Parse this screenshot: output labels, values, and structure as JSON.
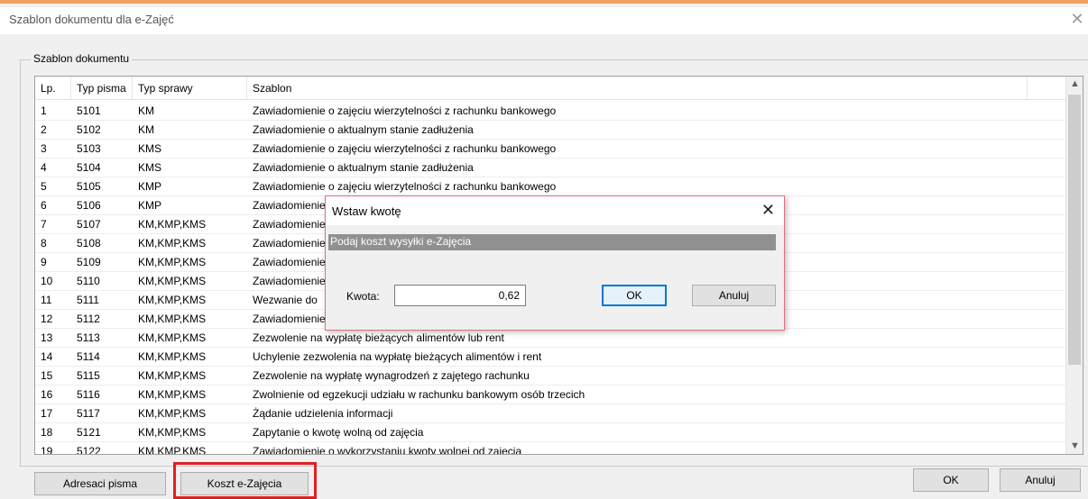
{
  "window": {
    "title": "Szablon dokumentu dla e-Zajęć",
    "close_glyph": "✕"
  },
  "group": {
    "label": "Szablon dokumentu"
  },
  "grid": {
    "columns": [
      "Lp.",
      "Typ pisma",
      "Typ sprawy",
      "Szablon"
    ],
    "rows": [
      [
        "1",
        "5101",
        "KM",
        "Zawiadomienie o zajęciu wierzytelności z rachunku bankowego"
      ],
      [
        "2",
        "5102",
        "KM",
        "Zawiadomienie o aktualnym stanie zadłużenia"
      ],
      [
        "3",
        "5103",
        "KMS",
        "Zawiadomienie o zajęciu wierzytelności z rachunku bankowego"
      ],
      [
        "4",
        "5104",
        "KMS",
        "Zawiadomienie o aktualnym stanie zadłużenia"
      ],
      [
        "5",
        "5105",
        "KMP",
        "Zawiadomienie o zajęciu wierzytelności z rachunku bankowego"
      ],
      [
        "6",
        "5106",
        "KMP",
        "Zawiadomienie"
      ],
      [
        "7",
        "5107",
        "KM,KMP,KMS",
        "Zawiadomienie"
      ],
      [
        "8",
        "5108",
        "KM,KMP,KMS",
        "Zawiadomienie"
      ],
      [
        "9",
        "5109",
        "KM,KMP,KMS",
        "Zawiadomienie"
      ],
      [
        "10",
        "5110",
        "KM,KMP,KMS",
        "Zawiadomienie"
      ],
      [
        "11",
        "5111",
        "KM,KMP,KMS",
        "Wezwanie do"
      ],
      [
        "12",
        "5112",
        "KM,KMP,KMS",
        "Zawiadomienie"
      ],
      [
        "13",
        "5113",
        "KM,KMP,KMS",
        "Zezwolenie na wypłatę bieżących alimentów lub rent"
      ],
      [
        "14",
        "5114",
        "KM,KMP,KMS",
        "Uchylenie zezwolenia na wypłatę bieżących alimentów i rent"
      ],
      [
        "15",
        "5115",
        "KM,KMP,KMS",
        "Zezwolenie na wypłatę wynagrodzeń z zajętego rachunku"
      ],
      [
        "16",
        "5116",
        "KM,KMP,KMS",
        "Zwolnienie od egzekucji udziału w rachunku bankowym osób trzecich"
      ],
      [
        "17",
        "5117",
        "KM,KMP,KMS",
        "Żądanie udzielenia informacji"
      ],
      [
        "18",
        "5121",
        "KM,KMP,KMS",
        "Zapytanie o kwotę wolną od zajęcia"
      ],
      [
        "19",
        "5122",
        "KM,KMP,KMS",
        "Zawiadomienie o wykorzystaniu kwoty wolnej od zajęcia"
      ]
    ],
    "scroll_up_glyph": "▲",
    "scroll_down_glyph": "▼"
  },
  "buttons": {
    "recipients": "Adresaci pisma",
    "cost": "Koszt e-Zajęcia",
    "ok": "OK",
    "cancel": "Anuluj"
  },
  "modal": {
    "title": "Wstaw kwotę",
    "close_glyph": "✕",
    "prompt": "Podaj koszt wysyłki e-Zajęcia",
    "amount_label": "Kwota:",
    "amount_value": "0,62",
    "ok": "OK",
    "cancel": "Anuluj"
  },
  "colors": {
    "highlight": "#e02020",
    "focus": "#0078d7",
    "band": "#909090"
  }
}
